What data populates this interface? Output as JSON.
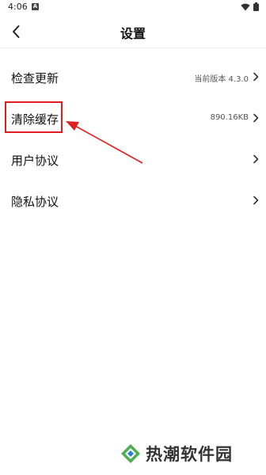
{
  "status_bar": {
    "time": "4:06",
    "notification_icon": "a-app-icon",
    "wifi_icon": "wifi-icon",
    "battery_icon": "battery-icon"
  },
  "header": {
    "title": "设置",
    "back_icon": "chevron-left-icon"
  },
  "settings": {
    "items": [
      {
        "label": "检查更新",
        "value": "当前版本 4.3.0"
      },
      {
        "label": "清除缓存",
        "value": "890.16KB"
      },
      {
        "label": "用户协议",
        "value": ""
      },
      {
        "label": "隐私协议",
        "value": ""
      }
    ]
  },
  "annotation": {
    "color": "#e02020"
  },
  "watermark": {
    "text": "热潮软件园"
  }
}
